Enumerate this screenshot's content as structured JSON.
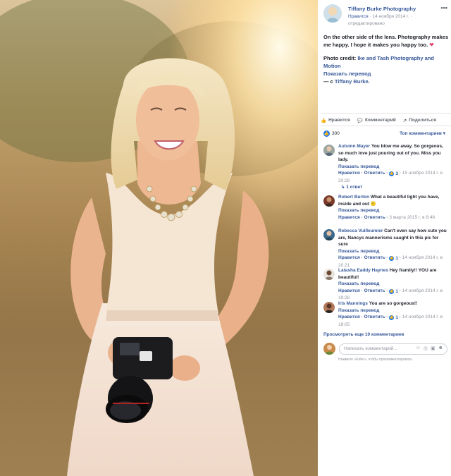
{
  "post": {
    "author": "Tiffany Burke Photography",
    "like_label": "Нравится",
    "date": "14 ноября 2014 г.",
    "edited": "отредактировано",
    "more_icon": "more-icon",
    "text": "On the other side of the lens. Photography makes me happy. I hope it makes you happy too.",
    "heart": "❤",
    "credit_label": "Photo credit:",
    "credit_name": "Ike and Tash Photography and Motion",
    "translate": "Показать перевод",
    "with_prefix": "— с",
    "with_name": "Tiffany Burke."
  },
  "actions": {
    "like": "Нравится",
    "comment": "Комментарий",
    "share": "Поделиться"
  },
  "reactions": {
    "count": "300",
    "sort": "Топ комментариев ▾"
  },
  "comments": [
    {
      "name": "Autumn Mayer",
      "text": "You blow me away. So gorgeous, so much love just pouring out of you. Miss you lady.",
      "translate": "Показать перевод",
      "like": "Нравится",
      "reply": "Ответить",
      "likes": "3",
      "date": "15 ноября 2014 г. в 20:28",
      "replies": "↳ 1 ответ"
    },
    {
      "name": "Robert Burton",
      "text": "What a beautiful light you have, inside and out 🙂",
      "translate": "Показать перевод",
      "like": "Нравится",
      "reply": "Ответить",
      "likes": "",
      "date": "3 марта 2015 г. в 8:48"
    },
    {
      "name": "Rebecca Vuilleumier",
      "text": "Can't even say how cute you are, Nancys mannerisms caught in this pic for sure",
      "translate": "Показать перевод",
      "like": "Нравится",
      "reply": "Ответить",
      "likes": "1",
      "date": "14 ноября 2014 г. в 20:21"
    },
    {
      "name": "Latasha Eaddy Haynes",
      "text": "Hey framily!! YOU are beautiful!",
      "translate": "Показать перевод",
      "like": "Нравится",
      "reply": "Ответить",
      "likes": "1",
      "date": "14 ноября 2014 г. в 19:28"
    },
    {
      "name": "Iris Mannings",
      "text": "You are so gorgeous!!",
      "translate": "Показать перевод",
      "like": "Нравится",
      "reply": "Ответить",
      "likes": "1",
      "date": "14 ноября 2014 г. в 18:05"
    }
  ],
  "more_comments": "Просмотреть еще 10 комментариев",
  "compose": {
    "placeholder": "Написать комментарий...",
    "hint": "Нажмите «Enter», чтобы прокомментировать."
  },
  "colors": {
    "link": "#365899",
    "like_blue": "#1877f2",
    "heart": "#e0456a"
  }
}
